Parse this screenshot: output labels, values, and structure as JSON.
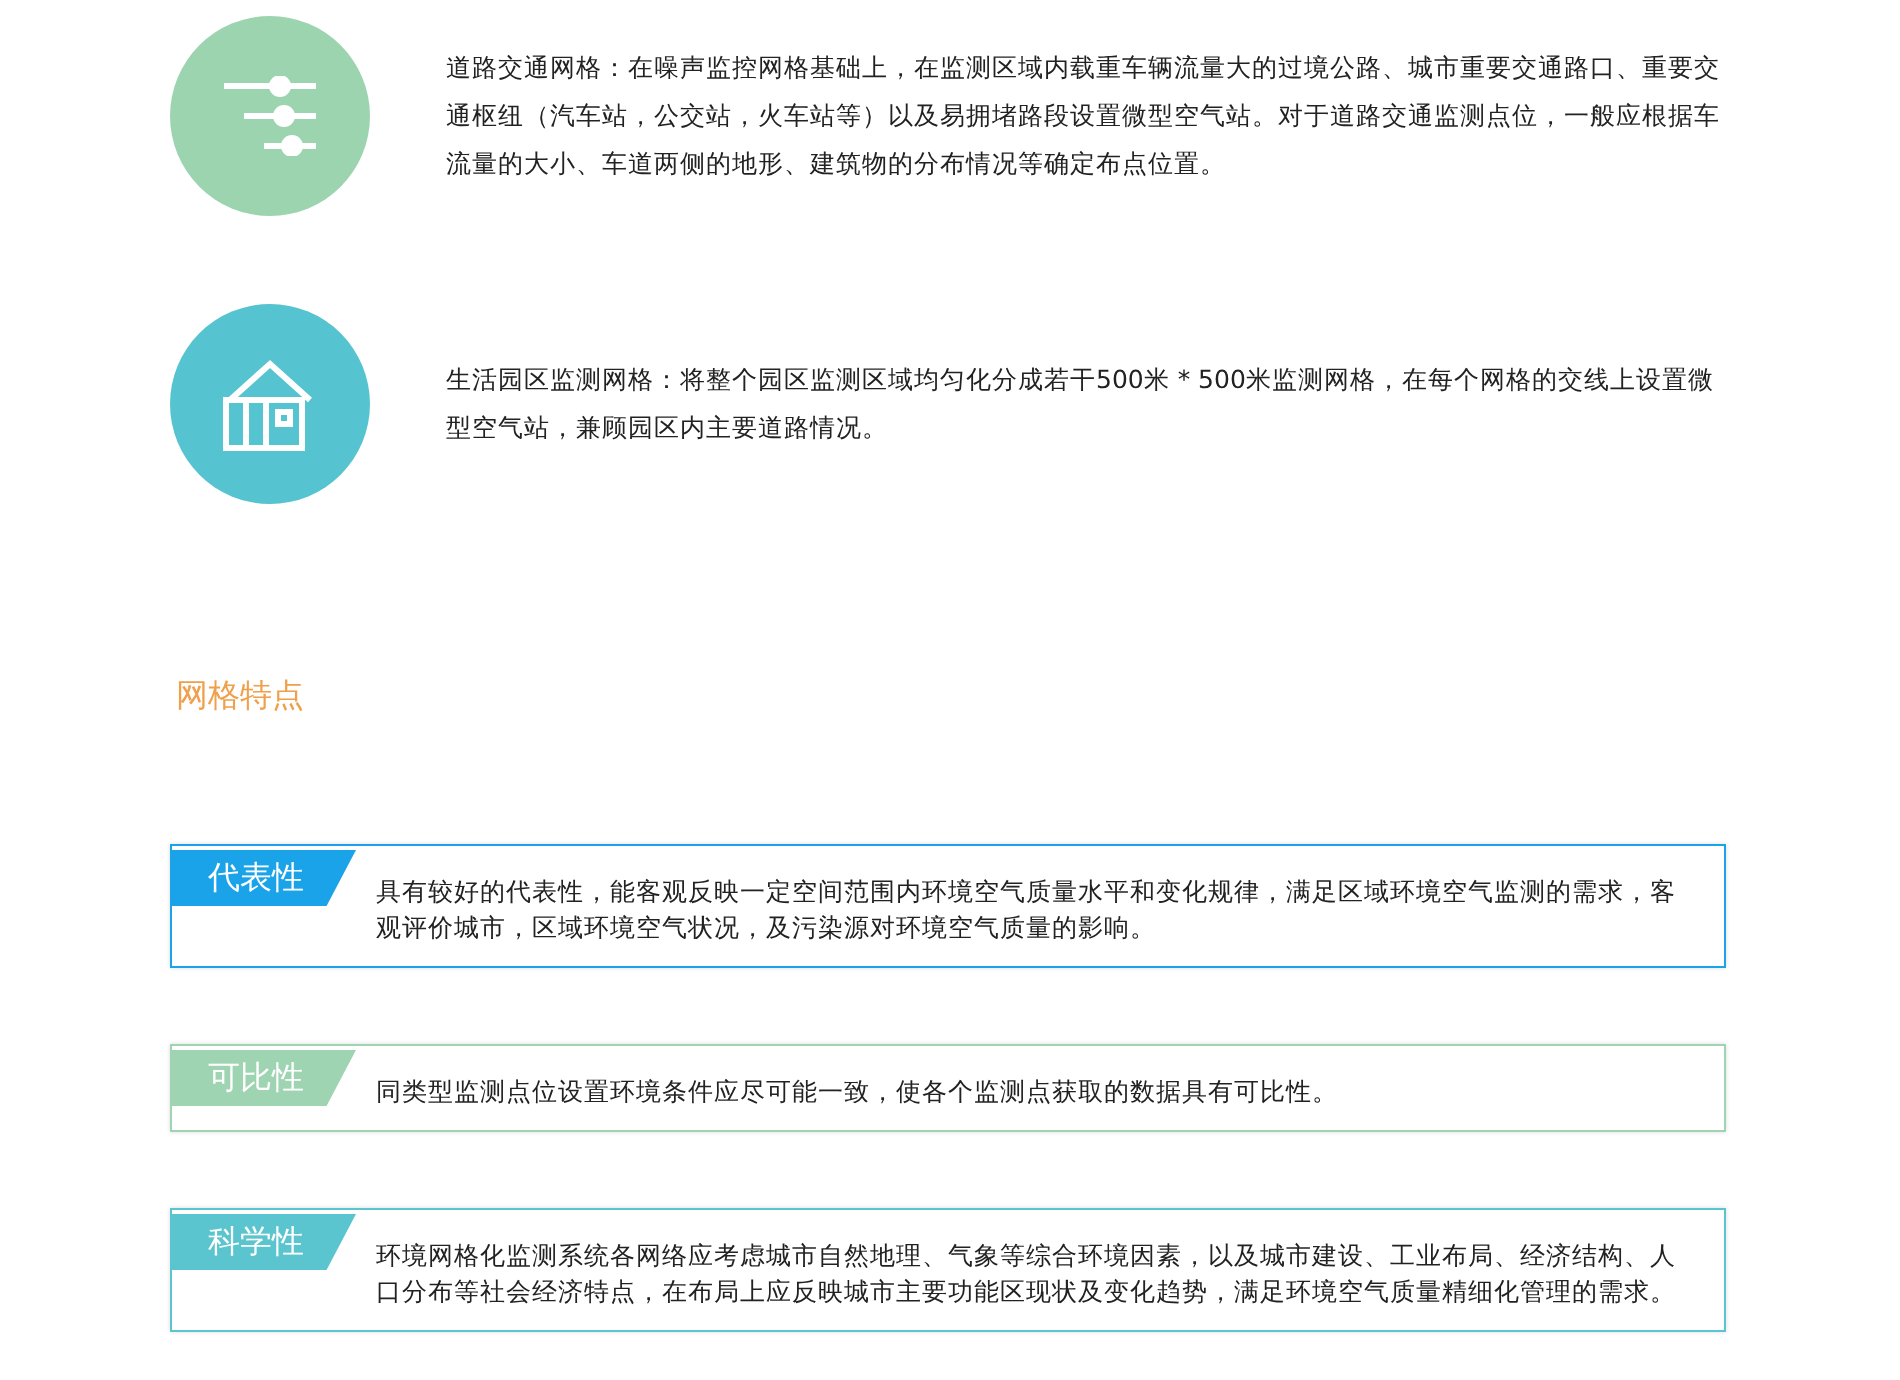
{
  "grids": [
    {
      "kind": "sliders",
      "color": "#9dd4b0",
      "text": "道路交通网格：在噪声监控网格基础上，在监测区域内载重车辆流量大的过境公路、城市重要交通路口、重要交通枢纽（汽车站，公交站，火车站等）以及易拥堵路段设置微型空气站。对于道路交通监测点位，一般应根据车流量的大小、车道两侧的地形、建筑物的分布情况等确定布点位置。"
    },
    {
      "kind": "house",
      "color": "#56c4d0",
      "text": "生活园区监测网格：将整个园区监测区域均匀化分成若干500米 * 500米监测网格，在每个网格的交线上设置微型空气站，兼顾园区内主要道路情况。"
    }
  ],
  "section_title": "网格特点",
  "features": [
    {
      "tag": "代表性",
      "color": "#1aa3e8",
      "text": " 具有较好的代表性，能客观反映一定空间范围内环境空气质量水平和变化规律，满足区域环境空气监测的需求，客观评价城市，区域环境空气状况，及污染源对环境空气质量的影响。"
    },
    {
      "tag": "可比性",
      "color": "#9fd4b2",
      "text": "同类型监测点位设置环境条件应尽可能一致，使各个监测点获取的数据具有可比性。"
    },
    {
      "tag": "科学性",
      "color": "#5bc5cf",
      "text": "环境网格化监测系统各网络应考虑城市自然地理、气象等综合环境因素，以及城市建设、工业布局、经济结构、人口分布等社会经济特点，在布局上应反映城市主要功能区现状及变化趋势，满足环境空气质量精细化管理的需求。"
    }
  ]
}
